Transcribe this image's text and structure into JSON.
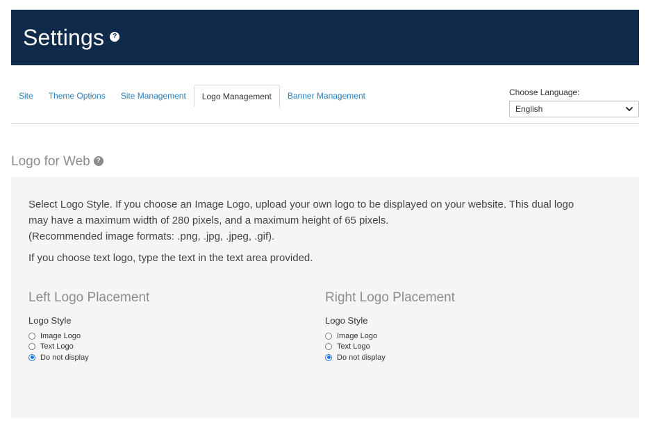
{
  "header": {
    "title": "Settings",
    "help_icon": "question-circle-icon"
  },
  "tabs": [
    {
      "label": "Site",
      "active": false
    },
    {
      "label": "Theme Options",
      "active": false
    },
    {
      "label": "Site Management",
      "active": false
    },
    {
      "label": "Logo Management",
      "active": true
    },
    {
      "label": "Banner Management",
      "active": false
    }
  ],
  "language": {
    "label": "Choose Language:",
    "selected": "English"
  },
  "section": {
    "title": "Logo for Web",
    "description_lines": [
      "Select Logo Style. If you choose an Image Logo, upload your own logo to be displayed on your website. This dual logo",
      "may have a maximum width of 280 pixels, and a maximum height of 65 pixels.",
      "(Recommended image formats: .png, .jpg, .jpeg, .gif)."
    ],
    "description2": "If you choose text logo, type the text in the text area provided."
  },
  "left_column": {
    "title": "Left Logo Placement",
    "logo_style_label": "Logo Style",
    "options": [
      "Image Logo",
      "Text Logo",
      "Do not display"
    ],
    "selected_index": 2
  },
  "right_column": {
    "title": "Right Logo Placement",
    "logo_style_label": "Logo Style",
    "options": [
      "Image Logo",
      "Text Logo",
      "Do not display"
    ],
    "selected_index": 2
  },
  "colors": {
    "header_bg": "#0f2a4a",
    "link": "#2a7fbf",
    "panel_bg": "#f5f5f5",
    "radio_accent": "#1a73e8"
  }
}
